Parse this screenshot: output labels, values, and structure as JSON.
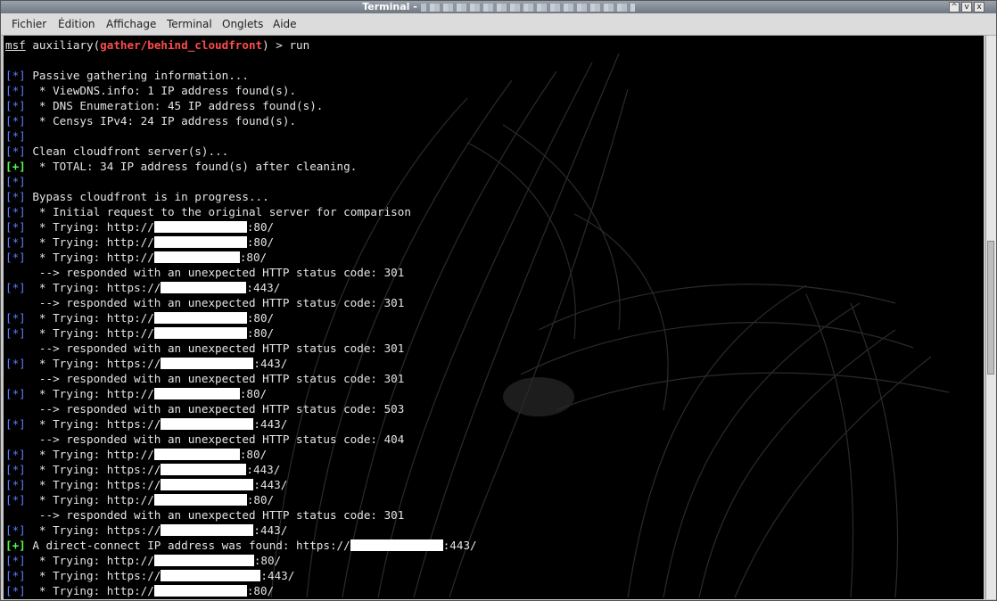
{
  "window": {
    "title": "Terminal -",
    "buttons": [
      "^",
      "v",
      "x"
    ]
  },
  "menubar": [
    "Fichier",
    "Édition",
    "Affichage",
    "Terminal",
    "Onglets",
    "Aide"
  ],
  "prompt": {
    "msf": "msf",
    "text": " auxiliary(",
    "module": "gather/behind_cloudfront",
    "end": ") > run"
  },
  "lines": [
    {
      "tag": "",
      "text": "",
      "redact": 0,
      "after": ""
    },
    {
      "tag": "[*]",
      "color": "blue",
      "text": " Passive gathering information...",
      "redact": 0,
      "after": ""
    },
    {
      "tag": "[*]",
      "color": "blue",
      "text": "  * ViewDNS.info: 1 IP address found(s).",
      "redact": 0,
      "after": ""
    },
    {
      "tag": "[*]",
      "color": "blue",
      "text": "  * DNS Enumeration: 45 IP address found(s).",
      "redact": 0,
      "after": ""
    },
    {
      "tag": "[*]",
      "color": "blue",
      "text": "  * Censys IPv4: 24 IP address found(s).",
      "redact": 0,
      "after": ""
    },
    {
      "tag": "[*]",
      "color": "blue",
      "text": "",
      "redact": 0,
      "after": ""
    },
    {
      "tag": "[*]",
      "color": "blue",
      "text": " Clean cloudfront server(s)...",
      "redact": 0,
      "after": ""
    },
    {
      "tag": "[+]",
      "color": "green",
      "text": "  * TOTAL: 34 IP address found(s) after cleaning.",
      "redact": 0,
      "after": ""
    },
    {
      "tag": "[*]",
      "color": "blue",
      "text": "",
      "redact": 0,
      "after": ""
    },
    {
      "tag": "[*]",
      "color": "blue",
      "text": " Bypass cloudfront is in progress...",
      "redact": 0,
      "after": ""
    },
    {
      "tag": "[*]",
      "color": "blue",
      "text": "  * Initial request to the original server for comparison",
      "redact": 0,
      "after": ""
    },
    {
      "tag": "[*]",
      "color": "blue",
      "text": "  * Trying: http://",
      "redact": 104,
      "after": ":80/"
    },
    {
      "tag": "[*]",
      "color": "blue",
      "text": "  * Trying: http://",
      "redact": 104,
      "after": ":80/"
    },
    {
      "tag": "[*]",
      "color": "blue",
      "text": "  * Trying: http://",
      "redact": 96,
      "after": ":80/"
    },
    {
      "tag": "",
      "text": "     --> responded with an unexpected HTTP status code: 301",
      "redact": 0,
      "after": ""
    },
    {
      "tag": "[*]",
      "color": "blue",
      "text": "  * Trying: https://",
      "redact": 96,
      "after": ":443/"
    },
    {
      "tag": "",
      "text": "     --> responded with an unexpected HTTP status code: 301",
      "redact": 0,
      "after": ""
    },
    {
      "tag": "[*]",
      "color": "blue",
      "text": "  * Trying: http://",
      "redact": 104,
      "after": ":80/"
    },
    {
      "tag": "[*]",
      "color": "blue",
      "text": "  * Trying: http://",
      "redact": 104,
      "after": ":80/"
    },
    {
      "tag": "",
      "text": "     --> responded with an unexpected HTTP status code: 301",
      "redact": 0,
      "after": ""
    },
    {
      "tag": "[*]",
      "color": "blue",
      "text": "  * Trying: https://",
      "redact": 104,
      "after": ":443/"
    },
    {
      "tag": "",
      "text": "     --> responded with an unexpected HTTP status code: 301",
      "redact": 0,
      "after": ""
    },
    {
      "tag": "[*]",
      "color": "blue",
      "text": "  * Trying: http://",
      "redact": 96,
      "after": ":80/"
    },
    {
      "tag": "",
      "text": "     --> responded with an unexpected HTTP status code: 503",
      "redact": 0,
      "after": ""
    },
    {
      "tag": "[*]",
      "color": "blue",
      "text": "  * Trying: https://",
      "redact": 104,
      "after": ":443/"
    },
    {
      "tag": "",
      "text": "     --> responded with an unexpected HTTP status code: 404",
      "redact": 0,
      "after": ""
    },
    {
      "tag": "[*]",
      "color": "blue",
      "text": "  * Trying: http://",
      "redact": 96,
      "after": ":80/"
    },
    {
      "tag": "[*]",
      "color": "blue",
      "text": "  * Trying: https://",
      "redact": 96,
      "after": ":443/"
    },
    {
      "tag": "[*]",
      "color": "blue",
      "text": "  * Trying: https://",
      "redact": 104,
      "after": ":443/"
    },
    {
      "tag": "[*]",
      "color": "blue",
      "text": "  * Trying: http://",
      "redact": 104,
      "after": ":80/"
    },
    {
      "tag": "",
      "text": "     --> responded with an unexpected HTTP status code: 301",
      "redact": 0,
      "after": ""
    },
    {
      "tag": "[*]",
      "color": "blue",
      "text": "  * Trying: https://",
      "redact": 104,
      "after": ":443/"
    },
    {
      "tag": "[+]",
      "color": "green",
      "text": " A direct-connect IP address was found: https://",
      "redact": 104,
      "after": ":443/"
    },
    {
      "tag": "[*]",
      "color": "blue",
      "text": "  * Trying: http://",
      "redact": 112,
      "after": ":80/"
    },
    {
      "tag": "[*]",
      "color": "blue",
      "text": "  * Trying: https://",
      "redact": 112,
      "after": ":443/"
    },
    {
      "tag": "[*]",
      "color": "blue",
      "text": "  * Trying: http://",
      "redact": 104,
      "after": ":80/"
    }
  ],
  "colors": {
    "blue_tag": "#5c7cff",
    "green_tag": "#4fff4f",
    "module": "#ff4b4b",
    "background": "#000000",
    "text": "#e4e4e4"
  }
}
